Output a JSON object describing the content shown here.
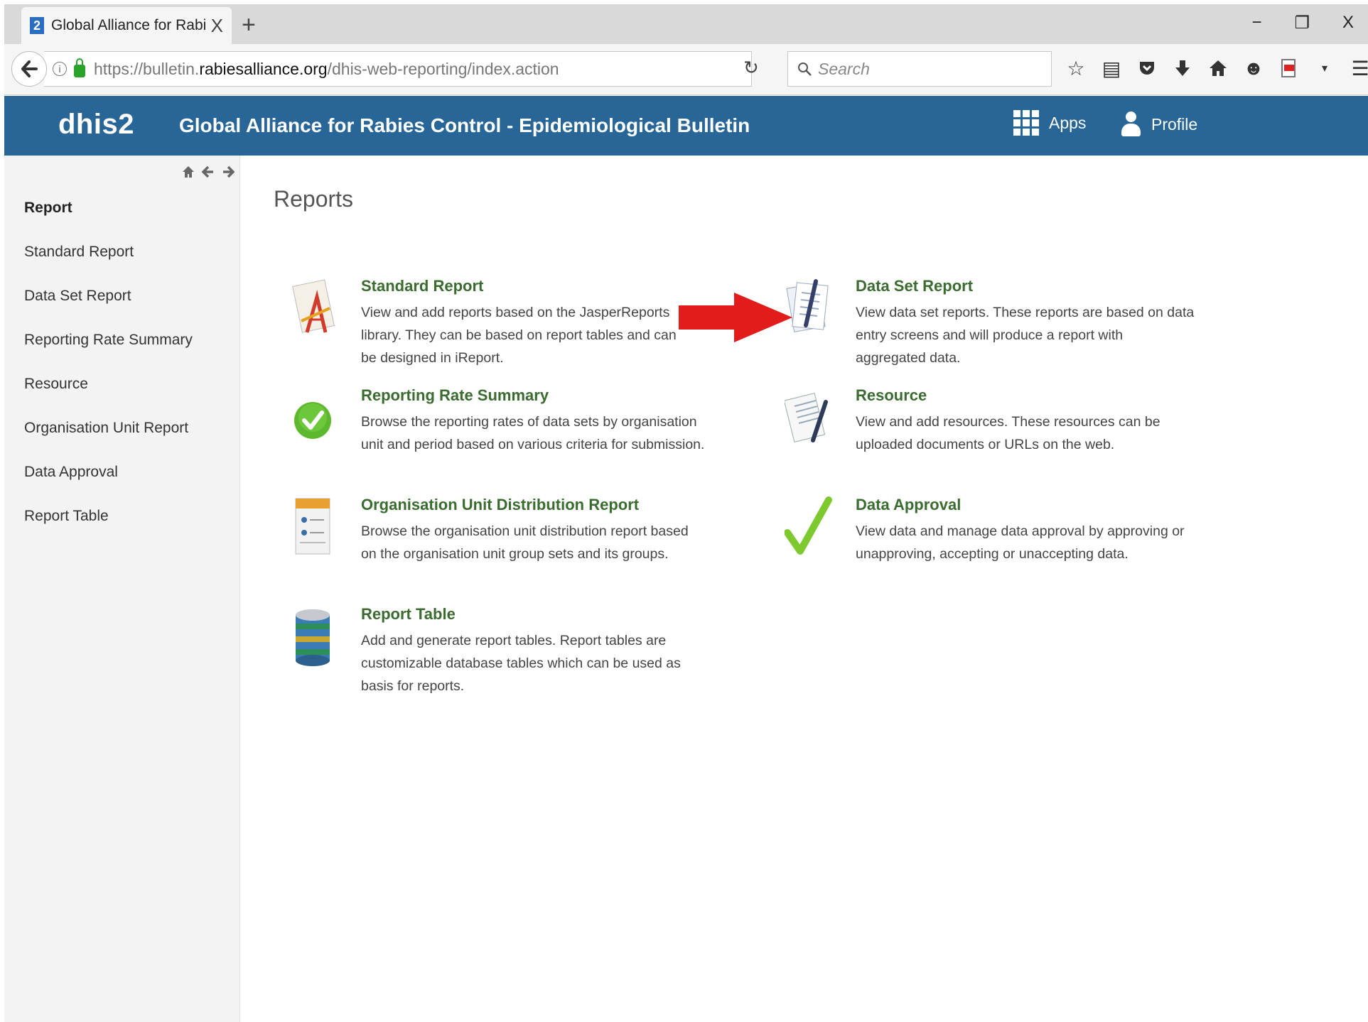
{
  "browser": {
    "tab_title": "Global Alliance for Rabies ...",
    "tab_favicon_text": "2",
    "tab_close": "X",
    "new_tab": "+",
    "window_controls": [
      "−",
      "❐",
      "X"
    ],
    "url_prefix": "https://bulletin.",
    "url_host": "rabiesalliance.org",
    "url_path": "/dhis-web-reporting/index.action",
    "search_placeholder": "Search",
    "toolbar_icons": [
      "star-icon",
      "reading-list-icon",
      "pocket-icon",
      "download-icon",
      "home-icon",
      "smiley-icon",
      "pdf-icon",
      "dropdown-icon",
      "menu-icon"
    ]
  },
  "header": {
    "logo": "dhis2",
    "title": "Global Alliance for Rabies Control - Epidemiological Bulletin",
    "apps_label": "Apps",
    "profile_label": "Profile",
    "color": "#276696"
  },
  "sidebar": {
    "nav_icons": [
      "home-icon",
      "back-arrow-icon",
      "forward-arrow-icon"
    ],
    "heading": "Report",
    "items": [
      {
        "label": "Standard Report"
      },
      {
        "label": "Data Set Report"
      },
      {
        "label": "Reporting Rate Summary"
      },
      {
        "label": "Resource"
      },
      {
        "label": "Organisation Unit Report"
      },
      {
        "label": "Data Approval"
      },
      {
        "label": "Report Table"
      }
    ]
  },
  "main": {
    "title": "Reports",
    "cards": [
      {
        "title": "Standard Report",
        "description": "View and add reports based on the JasperReports library. They can be based on report tables and can be designed in iReport.",
        "icon": "drawing-tools-icon"
      },
      {
        "title": "Data Set Report",
        "description": "View data set reports. These reports are based on data entry screens and will produce a report with aggregated data.",
        "icon": "document-pen-icon"
      },
      {
        "title": "Reporting Rate Summary",
        "description": "Browse the reporting rates of data sets by organisation unit and period based on various criteria for submission.",
        "icon": "green-check-circle-icon"
      },
      {
        "title": "Resource",
        "description": "View and add resources. These resources can be uploaded documents or URLs on the web.",
        "icon": "resource-document-icon"
      },
      {
        "title": "Organisation Unit Distribution Report",
        "description": "Browse the organisation unit distribution report based on the organisation unit group sets and its groups.",
        "icon": "org-unit-report-icon"
      },
      {
        "title": "Data Approval",
        "description": "View data and manage data approval by approving or unapproving, accepting or unaccepting data.",
        "icon": "checkmark-icon"
      },
      {
        "title": "Report Table",
        "description": "Add and generate report tables. Report tables are customizable database tables which can be used as basis for reports.",
        "icon": "database-icon"
      }
    ],
    "link_color": "#3a6b2f",
    "annotation_arrow_color": "#e02020"
  }
}
